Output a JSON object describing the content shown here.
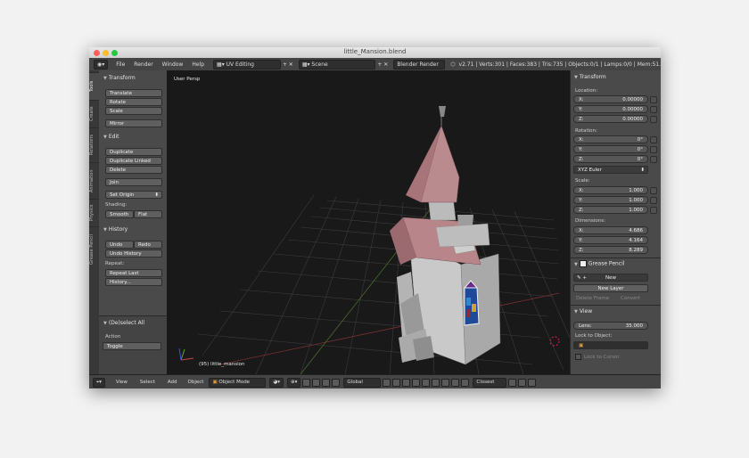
{
  "window": {
    "title": "little_Mansion.blend"
  },
  "infobar": {
    "menus": [
      "File",
      "Render",
      "Window",
      "Help"
    ],
    "screen_layout": "UV Editing",
    "scene": "Scene",
    "engine": "Blender Render",
    "stats": "v2.71 | Verts:301 | Faces:383 | Tris:735 | Objects:0/1 | Lamps:0/0 | Mem:51."
  },
  "tool_tabs": [
    "Tools",
    "Create",
    "Relations",
    "Animation",
    "Physics",
    "Grease Pencil"
  ],
  "tool_shelf": {
    "transform_header": "Transform",
    "transform_buttons": [
      "Translate",
      "Rotate",
      "Scale",
      "Mirror"
    ],
    "edit_header": "Edit",
    "edit_buttons": [
      "Duplicate",
      "Duplicate Linked",
      "Delete",
      "Join"
    ],
    "set_origin": "Set Origin",
    "shading_label": "Shading:",
    "shading_buttons": [
      "Smooth",
      "Flat"
    ],
    "history_header": "History",
    "undo": "Undo",
    "redo": "Redo",
    "undo_history": "Undo History",
    "repeat_label": "Repeat:",
    "repeat_last": "Repeat Last",
    "history_btn": "History...",
    "operator_header": "(De)select All",
    "action_label": "Action",
    "action_value": "Toggle"
  },
  "viewport": {
    "label": "User Persp",
    "object_label": "(95) little_mansion"
  },
  "properties": {
    "transform_header": "Transform",
    "location_label": "Location:",
    "location": [
      {
        "axis": "X:",
        "value": "0.00000"
      },
      {
        "axis": "Y:",
        "value": "0.00000"
      },
      {
        "axis": "Z:",
        "value": "0.00000"
      }
    ],
    "rotation_label": "Rotation:",
    "rotation": [
      {
        "axis": "X:",
        "value": "0°"
      },
      {
        "axis": "Y:",
        "value": "0°"
      },
      {
        "axis": "Z:",
        "value": "0°"
      }
    ],
    "rotation_mode": "XYZ Euler",
    "scale_label": "Scale:",
    "scale": [
      {
        "axis": "X:",
        "value": "1.000"
      },
      {
        "axis": "Y:",
        "value": "1.000"
      },
      {
        "axis": "Z:",
        "value": "1.000"
      }
    ],
    "dimensions_label": "Dimensions:",
    "dimensions": [
      {
        "axis": "X:",
        "value": "4.686"
      },
      {
        "axis": "Y:",
        "value": "4.164"
      },
      {
        "axis": "Z:",
        "value": "8.289"
      }
    ],
    "grease_header": "Grease Pencil",
    "grease_new": "New",
    "grease_new_layer": "New Layer",
    "grease_delete_frame": "Delete Frame",
    "grease_convert": "Convert",
    "view_header": "View",
    "lens_label": "Lens:",
    "lens_value": "35.000",
    "lock_to_object": "Lock to Object:",
    "lock_to_cursor": "Lock to Cursor"
  },
  "bottombar": {
    "menus": [
      "View",
      "Select",
      "Add",
      "Object"
    ],
    "mode": "Object Mode",
    "orientation": "Global",
    "snap": "Closest"
  }
}
